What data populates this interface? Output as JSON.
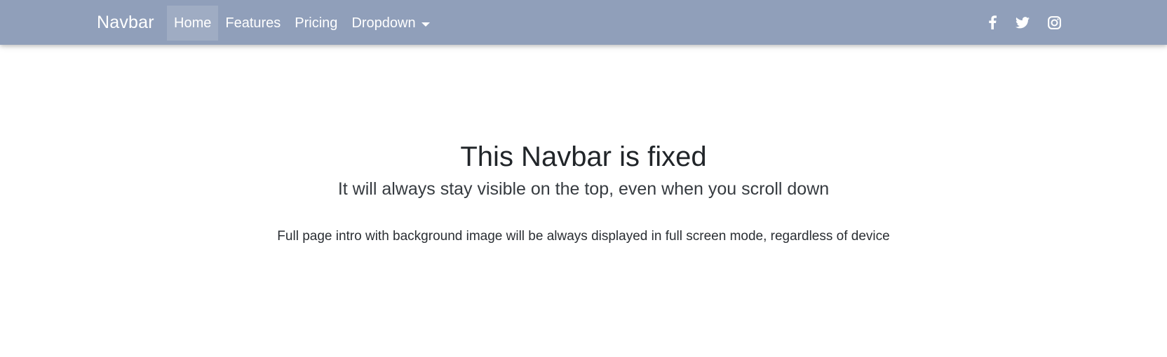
{
  "navbar": {
    "brand": "Navbar",
    "background_color": "#909fba",
    "links": [
      {
        "label": "Home",
        "active": true
      },
      {
        "label": "Features",
        "active": false
      },
      {
        "label": "Pricing",
        "active": false
      },
      {
        "label": "Dropdown",
        "active": false,
        "has_caret": true
      }
    ],
    "social_icons": [
      "facebook-icon",
      "twitter-icon",
      "instagram-icon"
    ]
  },
  "hero": {
    "title": "This Navbar is fixed",
    "subtitle": "It will always stay visible on the top, even when you scroll down",
    "text": "Full page intro with background image will be always displayed in full screen mode, regardless of device"
  }
}
